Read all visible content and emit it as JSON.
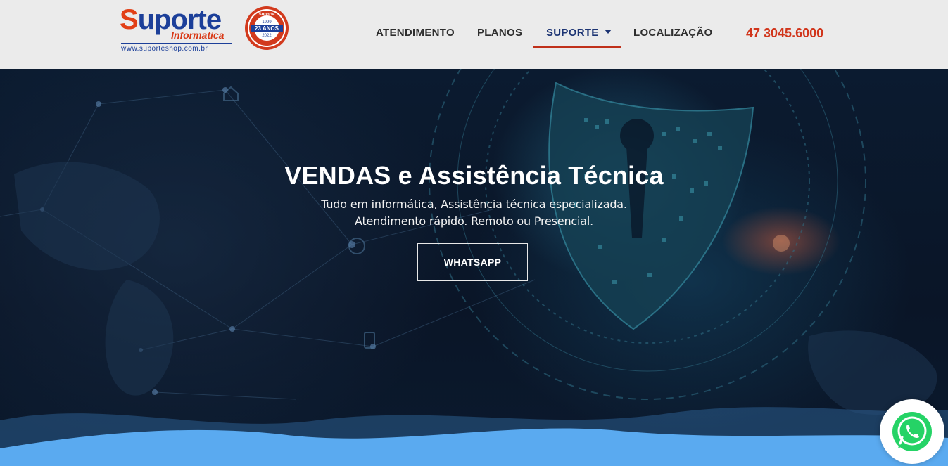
{
  "logo": {
    "name_part1": "S",
    "name_part2": "uporte",
    "subtitle": "Informatica",
    "url": "www.suporteshop.com.br",
    "seal_top": "Suporte",
    "seal_years_top": "1999",
    "seal_anos": "23 ANOS",
    "seal_years_bottom": "2022"
  },
  "nav": {
    "items": [
      {
        "label": "ATENDIMENTO"
      },
      {
        "label": "PLANOS"
      },
      {
        "label": "SUPORTE"
      },
      {
        "label": "LOCALIZAÇÃO"
      }
    ],
    "phone": "47 3045.6000"
  },
  "hero": {
    "title": "VENDAS e Assistência Técnica",
    "subtitle_line1": "Tudo em informática, Assistência técnica especializada.",
    "subtitle_line2": "Atendimento rápido. Remoto ou Presencial.",
    "button_label": "WHATSAPP"
  },
  "colors": {
    "brand_red": "#d1351b",
    "brand_blue": "#1c3473",
    "wave_light": "#5aaaf0",
    "whatsapp_green": "#25d366"
  }
}
